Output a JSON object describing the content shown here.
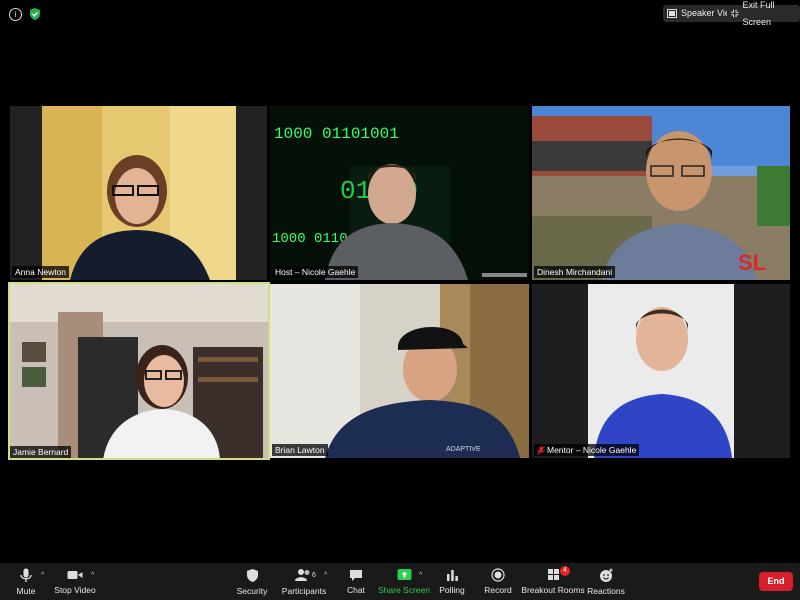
{
  "window": {
    "speaker_view_label": "Speaker View",
    "exit_fullscreen_label": "Exit Full Screen"
  },
  "participants_grid": [
    {
      "name": "Anna Newton"
    },
    {
      "name": "Host – Nicole Gaehle",
      "background_text_1": "1000 01101001",
      "background_text_2": "01010",
      "background_text_3": "1000 0110"
    },
    {
      "name": "Dinesh Mirchandani",
      "sign_text": "SL"
    },
    {
      "name": "Jamie Bernard",
      "active_speaker": true
    },
    {
      "name": "Brian Lawton",
      "shirt_text": "ADAPTIVE"
    },
    {
      "name": "Mentor – Nicole Gaehle",
      "muted": true
    }
  ],
  "toolbar": {
    "mute_label": "Mute",
    "stop_video_label": "Stop Video",
    "security_label": "Security",
    "participants_label": "Participants",
    "participants_count": "6",
    "chat_label": "Chat",
    "share_screen_label": "Share Screen",
    "polling_label": "Polling",
    "record_label": "Record",
    "breakout_label": "Breakout Rooms",
    "breakout_badge": "4",
    "reactions_label": "Reactions",
    "end_label": "End"
  },
  "colors": {
    "share_green": "#2dcf52",
    "end_red": "#d6202c",
    "active_speaker_border": "#cfe07a"
  }
}
